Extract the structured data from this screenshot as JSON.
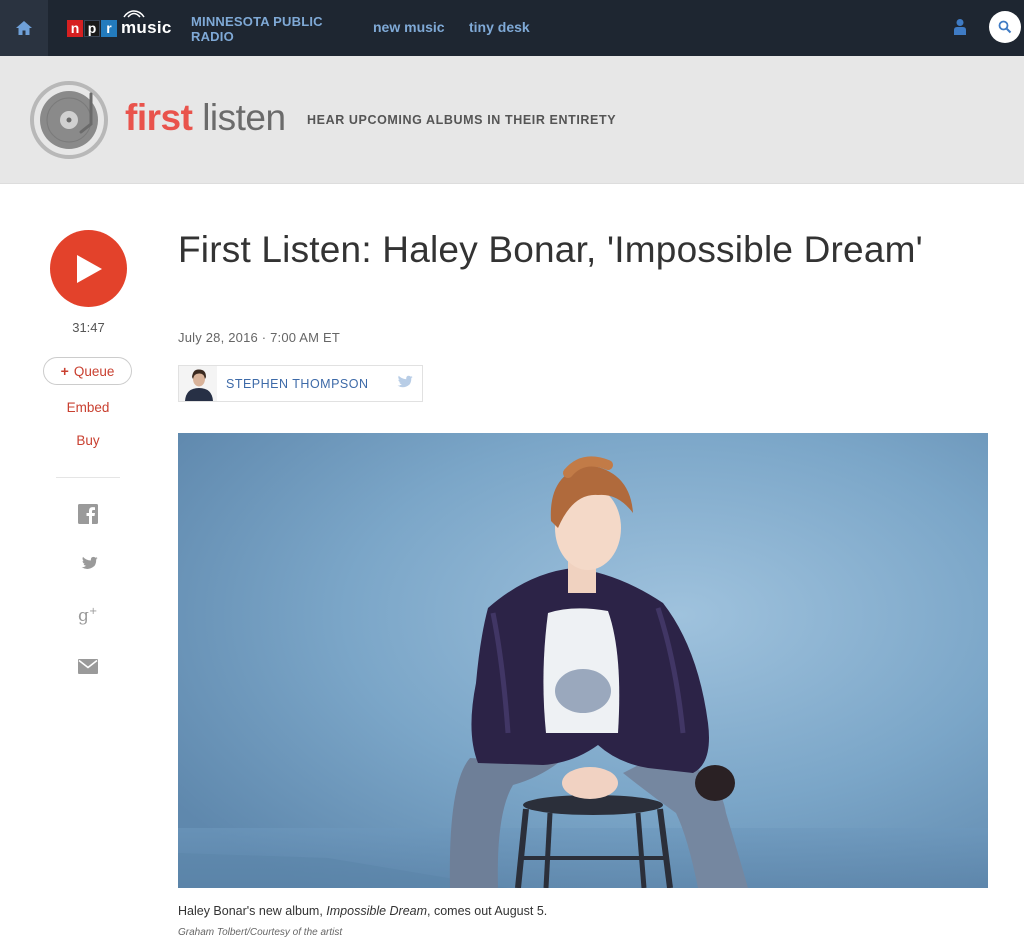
{
  "nav": {
    "logo": {
      "n": "n",
      "p": "p",
      "r": "r",
      "music": "music"
    },
    "station": "MINNESOTA PUBLIC RADIO",
    "links": [
      "new music",
      "tiny desk"
    ],
    "icons": [
      "home-icon",
      "user-icon",
      "search-icon"
    ]
  },
  "banner": {
    "title_first": "first",
    "title_listen": "listen",
    "tagline": "HEAR UPCOMING ALBUMS IN THEIR ENTIRETY",
    "icon": "vinyl-record-icon"
  },
  "player": {
    "duration": "31:47",
    "queue_label": "Queue",
    "queue_plus": "+",
    "embed_label": "Embed",
    "buy_label": "Buy",
    "share_icons": [
      "facebook-icon",
      "twitter-icon",
      "google-plus-icon",
      "email-icon"
    ]
  },
  "article": {
    "headline": "First Listen: Haley Bonar, 'Impossible Dream'",
    "dateline": "July 28, 2016 · 7:00 AM ET",
    "author": "STEPHEN THOMPSON",
    "caption_pre": "Haley Bonar's new album, ",
    "caption_em": "Impossible Dream",
    "caption_post": ", comes out August 5.",
    "credit": "Graham Tolbert/Courtesy of the artist"
  },
  "colors": {
    "nav_bg": "#1e2631",
    "nav_link": "#7fa9d6",
    "accent_red": "#e3422b",
    "link_red": "#c94030",
    "author_blue": "#3d6aa8",
    "banner_bg": "#e7e7e7"
  }
}
